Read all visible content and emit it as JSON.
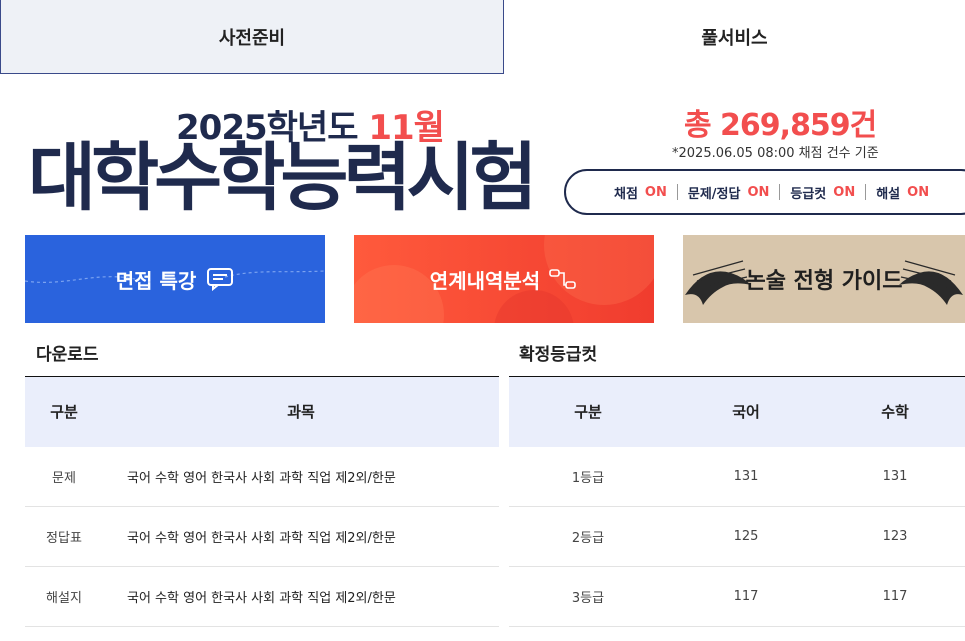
{
  "tabs": [
    {
      "label": "사전준비",
      "active": true
    },
    {
      "label": "풀서비스",
      "active": false
    }
  ],
  "hero": {
    "year_prefix": "2025학년도 ",
    "year_accent": "11월",
    "title": "대학수학능력시험"
  },
  "stats": {
    "count": "총 269,859건",
    "note": "*2025.06.05 08:00 채점 건수 기준"
  },
  "status": [
    {
      "label": "채점",
      "value": "ON"
    },
    {
      "label": "문제/정답",
      "value": "ON"
    },
    {
      "label": "등급컷",
      "value": "ON"
    },
    {
      "label": "해설",
      "value": "ON"
    }
  ],
  "banners": [
    {
      "text": "면접 특강",
      "icon": "chat-icon"
    },
    {
      "text": "연계내역분석",
      "icon": "flow-icon"
    },
    {
      "text": "논술 전형 가이드",
      "icon": "bird-icon"
    }
  ],
  "downloads": {
    "title": "다운로드",
    "headers": [
      "구분",
      "과목"
    ],
    "rows": [
      {
        "type": "문제",
        "subjects": "국어 수학 영어 한국사 사회 과학 직업 제2외/한문"
      },
      {
        "type": "정답표",
        "subjects": "국어 수학 영어 한국사 사회 과학 직업 제2외/한문"
      },
      {
        "type": "해설지",
        "subjects": "국어 수학 영어 한국사 사회 과학 직업 제2외/한문"
      }
    ]
  },
  "grade_cut": {
    "title": "확정등급컷",
    "headers": [
      "구분",
      "국어",
      "수학"
    ],
    "rows": [
      [
        "1등급",
        "131",
        "131"
      ],
      [
        "2등급",
        "125",
        "123"
      ],
      [
        "3등급",
        "117",
        "117"
      ]
    ]
  },
  "colors": {
    "navy": "#1f2a4d",
    "accent_red": "#f24e4e",
    "banner_blue": "#2a63dd",
    "banner_red": "#f03c2e",
    "banner_beige": "#d8c6ac",
    "table_header": "#eaeefb"
  }
}
